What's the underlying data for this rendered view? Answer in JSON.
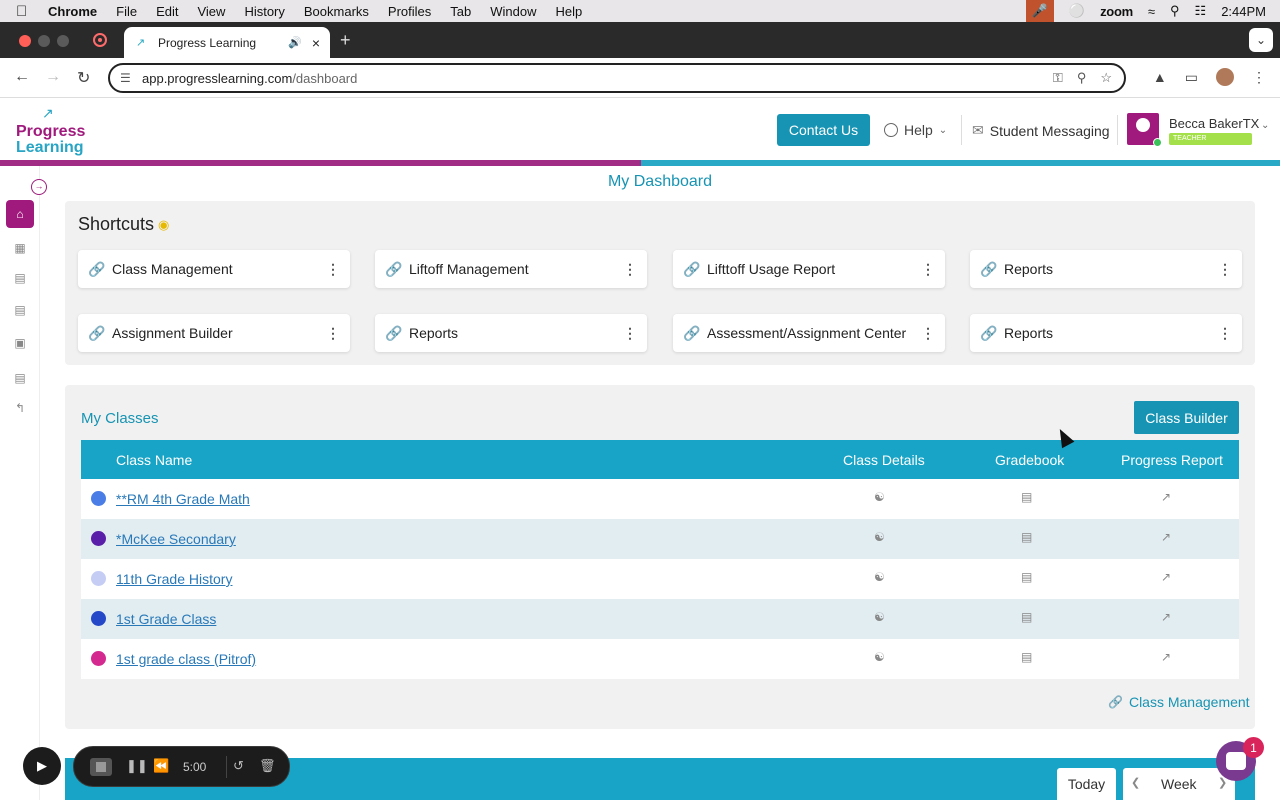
{
  "menubar": {
    "app": "Chrome",
    "items": [
      "File",
      "Edit",
      "View",
      "History",
      "Bookmarks",
      "Profiles",
      "Tab",
      "Window",
      "Help"
    ],
    "zoom_label": "zoom",
    "time": "2:44PM"
  },
  "browser": {
    "tab_title": "Progress Learning",
    "url_host": "app.progresslearning.com",
    "url_path": "/dashboard"
  },
  "header": {
    "logo_line1": "Progress",
    "logo_line2": "Learning",
    "contact_label": "Contact Us",
    "help_label": "Help",
    "messaging_label": "Student Messaging",
    "user_name": "Becca BakerTX",
    "user_role": "TEACHER"
  },
  "colors": {
    "brand_magenta": "#a01a7d",
    "brand_teal": "#1794b3",
    "table_header": "#17a4c7"
  },
  "page": {
    "title": "My Dashboard"
  },
  "shortcuts": {
    "title": "Shortcuts",
    "items": [
      {
        "label": "Class Management"
      },
      {
        "label": "Liftoff Management"
      },
      {
        "label": "Lifttoff Usage Report"
      },
      {
        "label": "Reports"
      },
      {
        "label": "Assignment Builder"
      },
      {
        "label": "Reports"
      },
      {
        "label": "Assessment/Assignment Center"
      },
      {
        "label": "Reports"
      }
    ]
  },
  "classes": {
    "title": "My Classes",
    "builder_label": "Class Builder",
    "columns": {
      "name": "Class Name",
      "details": "Class Details",
      "gradebook": "Gradebook",
      "progress": "Progress Report"
    },
    "rows": [
      {
        "name": "**RM 4th Grade Math",
        "color": "#4a7de6"
      },
      {
        "name": "*McKee Secondary",
        "color": "#5a1fa8"
      },
      {
        "name": "11th Grade History",
        "color": "#c5cdf5"
      },
      {
        "name": "1st Grade Class",
        "color": "#2548c9"
      },
      {
        "name": "1st grade class (Pitrof)",
        "color": "#d42a8f"
      }
    ],
    "management_link": "Class Management"
  },
  "assignments": {
    "today_label": "Today",
    "week_label": "Week"
  },
  "recorder": {
    "time": "5:00"
  },
  "chat": {
    "badge": "1"
  }
}
